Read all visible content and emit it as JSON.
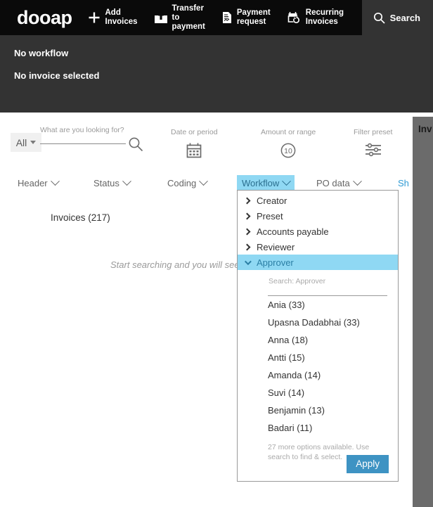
{
  "brand": "dooap",
  "topnav": {
    "items": [
      {
        "label_lines": [
          "Add",
          "Invoices"
        ],
        "icon": "plus-icon",
        "name": "add-invoices"
      },
      {
        "label_lines": [
          "Transfer",
          "to",
          "payment"
        ],
        "icon": "transfer-to-payment-icon",
        "name": "transfer-to-payment"
      },
      {
        "label_lines": [
          "Payment",
          "request"
        ],
        "icon": "payment-request-icon",
        "name": "payment-request"
      },
      {
        "label_lines": [
          "Recurring",
          "Invoices"
        ],
        "icon": "recurring-invoices-icon",
        "name": "recurring-invoices"
      }
    ],
    "search": {
      "label": "Search",
      "icon": "search-icon"
    }
  },
  "subheader": {
    "workflow_status": "No workflow",
    "invoice_status": "No invoice selected"
  },
  "searchbar": {
    "scope_value": "All",
    "query_label": "What are you looking for?",
    "query_value": "",
    "search_icon": "magnifier-icon",
    "tools": [
      {
        "label": "Date or period",
        "icon": "calendar-icon",
        "name": "date-or-period"
      },
      {
        "label": "Amount or range",
        "icon": "amount-circle-icon",
        "name": "amount-or-range"
      },
      {
        "label": "Filter preset",
        "icon": "sliders-icon",
        "name": "filter-preset"
      }
    ]
  },
  "filter_tabs": [
    {
      "label": "Header",
      "active": false,
      "name": "tab-header"
    },
    {
      "label": "Status",
      "active": false,
      "name": "tab-status"
    },
    {
      "label": "Coding",
      "active": false,
      "name": "tab-coding"
    },
    {
      "label": "Workflow",
      "active": true,
      "name": "tab-workflow"
    },
    {
      "label": "PO data",
      "active": false,
      "name": "tab-po-data"
    }
  ],
  "show_link": "Sh",
  "results": {
    "invoices_count_label": "Invoices (217)",
    "empty_message": "Start searching and you will see yo"
  },
  "right_panel": {
    "title": "Inv"
  },
  "workflow_dropdown": {
    "groups": [
      {
        "label": "Creator",
        "expanded": false
      },
      {
        "label": "Preset",
        "expanded": false
      },
      {
        "label": "Accounts payable",
        "expanded": false
      },
      {
        "label": "Reviewer",
        "expanded": false
      },
      {
        "label": "Approver",
        "expanded": true
      }
    ],
    "search_placeholder": "Search: Approver",
    "search_value": "",
    "options": [
      "Ania (33)",
      "Upasna Dadabhai (33)",
      "Anna (18)",
      "Antti (15)",
      "Amanda (14)",
      "Suvi (14)",
      "Benjamin (13)",
      "Badari (11)"
    ],
    "more_note": "27 more options available. Use search to find & select.",
    "apply_label": "Apply"
  },
  "colors": {
    "nav_bg": "#0a0a0a",
    "subheader_bg": "#333333",
    "accent_light_blue": "#8FD8F3",
    "apply_blue": "#3E93C3",
    "gray_panel": "#6B6B6B"
  }
}
